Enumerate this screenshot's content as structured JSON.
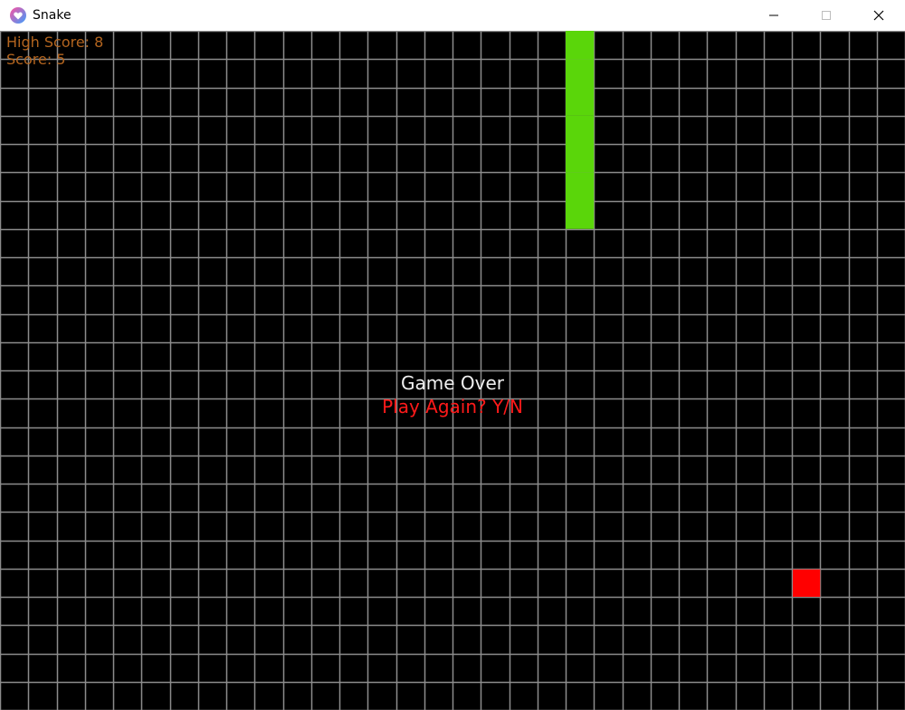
{
  "window": {
    "title": "Snake",
    "icon": "heart-app-icon",
    "controls": [
      "minimize-icon",
      "maximize-icon",
      "close-icon"
    ]
  },
  "hud": {
    "high_score": "High Score: 8",
    "score": "Score: 5"
  },
  "overlay": {
    "title": "Game Over",
    "prompt": "Play Again? Y/N"
  },
  "board": {
    "columns": 32,
    "rows": 24,
    "colors": {
      "background": "#000000",
      "grid": "#8c8c8c",
      "snake": "#5ad60a",
      "food": "#ff0000",
      "hud": "#b4651f",
      "title": "#f0f0f0",
      "prompt": "#ff1a1a"
    },
    "snake": [
      {
        "col": 20,
        "row": 0
      },
      {
        "col": 20,
        "row": 1
      },
      {
        "col": 20,
        "row": 2
      },
      {
        "col": 20,
        "row": 3
      },
      {
        "col": 20,
        "row": 4
      },
      {
        "col": 20,
        "row": 5
      },
      {
        "col": 20,
        "row": 6
      }
    ],
    "food": {
      "col": 28,
      "row": 19
    }
  }
}
